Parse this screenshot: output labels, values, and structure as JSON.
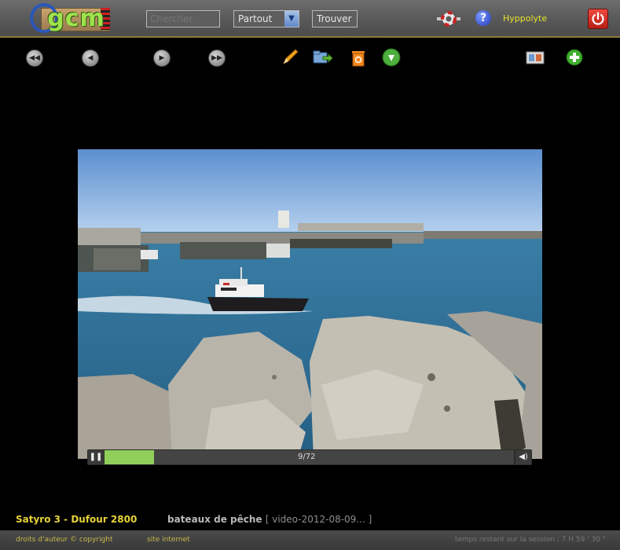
{
  "header": {
    "logo_text": "gcm",
    "search": {
      "placeholder": "Chercher",
      "value": ""
    },
    "scope_select": {
      "selected": "Partout"
    },
    "find_label": "Trouver",
    "username": "Hyppolyte"
  },
  "toolbar": {
    "icons": [
      "rewind-icon",
      "previous-icon",
      "play-icon",
      "fast-forward-icon",
      "pencil-icon",
      "move-folder-icon",
      "trash-icon",
      "download-icon",
      "slideshow-icon",
      "add-icon"
    ]
  },
  "player": {
    "time": "9/72",
    "progress": 0.12
  },
  "caption": {
    "title": "Satyro 3 - Dufour 2800",
    "description": "bateaux de pêche",
    "file": "[ video-2012-08-09... ]"
  },
  "footer": {
    "copyright": "droits d'auteur © copyright",
    "website": "site internet",
    "session": "temps restant sur la session : 7 H 59 ' 30 \""
  },
  "colors": {
    "accent_yellow": "#e5d13a",
    "progress_green": "#8fcf5a",
    "sea": "#2f6e94",
    "sky": "#6e9fd8"
  }
}
